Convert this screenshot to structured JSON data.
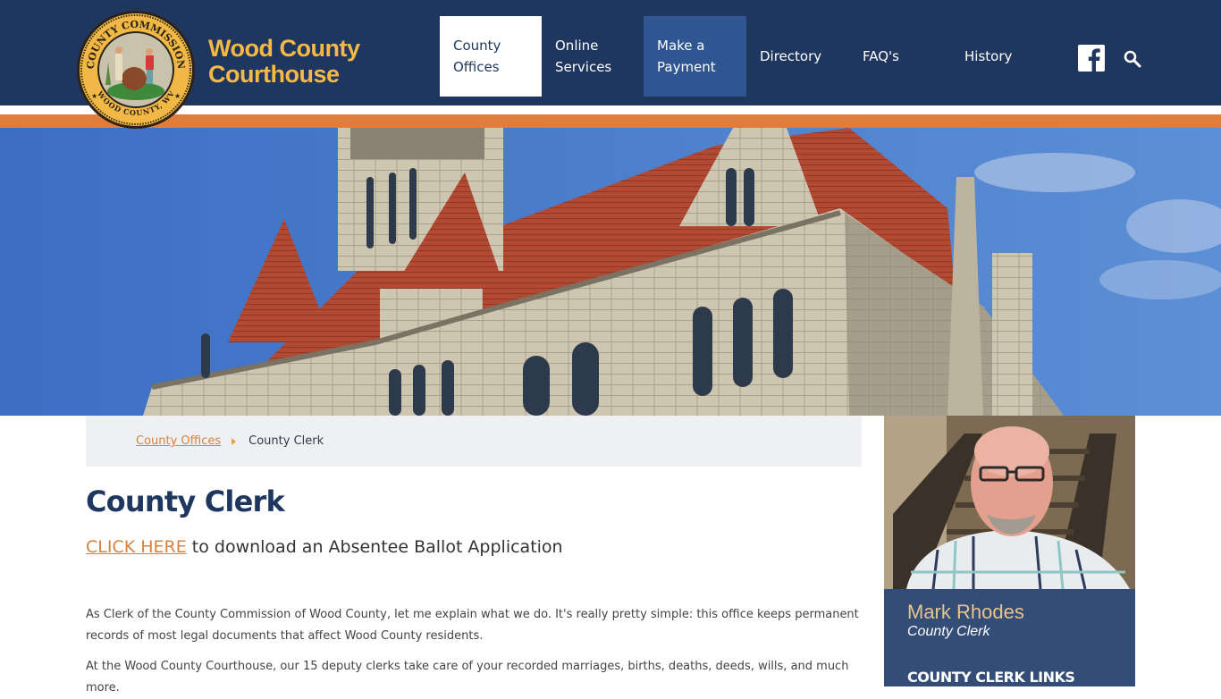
{
  "header": {
    "site_title_line1": "Wood County",
    "site_title_line2": "Courthouse",
    "seal_top_text": "COUNTY COMMISSION",
    "seal_bottom_text": "WOOD COUNTY, WV",
    "colors": {
      "navy": "#1f375e",
      "orange": "#e07d3c",
      "gold": "#f5b945",
      "highlight_blue": "#2f5690"
    }
  },
  "nav": {
    "items": [
      {
        "line1": "County",
        "line2": "Offices",
        "state": "active"
      },
      {
        "line1": "Online",
        "line2": "Services",
        "state": "normal"
      },
      {
        "line1": "Make a",
        "line2": "Payment",
        "state": "highlight"
      },
      {
        "line1": "Directory",
        "line2": "",
        "state": "normal"
      },
      {
        "line1": "FAQ's",
        "line2": "",
        "state": "normal"
      },
      {
        "line1": "History",
        "line2": "",
        "state": "normal"
      }
    ],
    "social_icon": "facebook-icon",
    "search_icon": "search-icon"
  },
  "breadcrumb": {
    "parent": "County Offices",
    "current": "County Clerk"
  },
  "main": {
    "title": "County Clerk",
    "absentee_link": "CLICK HERE",
    "absentee_text": " to download an Absentee Ballot Application",
    "paragraphs": [
      "As Clerk of the County Commission of Wood County, let me explain what we do. It's really pretty simple: this office keeps permanent records of most legal documents that affect Wood County residents.",
      "At the Wood County Courthouse, our 15 deputy clerks take care of your recorded marriages, births, deaths, deeds, wills, and much more."
    ]
  },
  "sidebar": {
    "name": "Mark Rhodes",
    "role": "County Clerk",
    "links_heading": "COUNTY CLERK LINKS"
  }
}
